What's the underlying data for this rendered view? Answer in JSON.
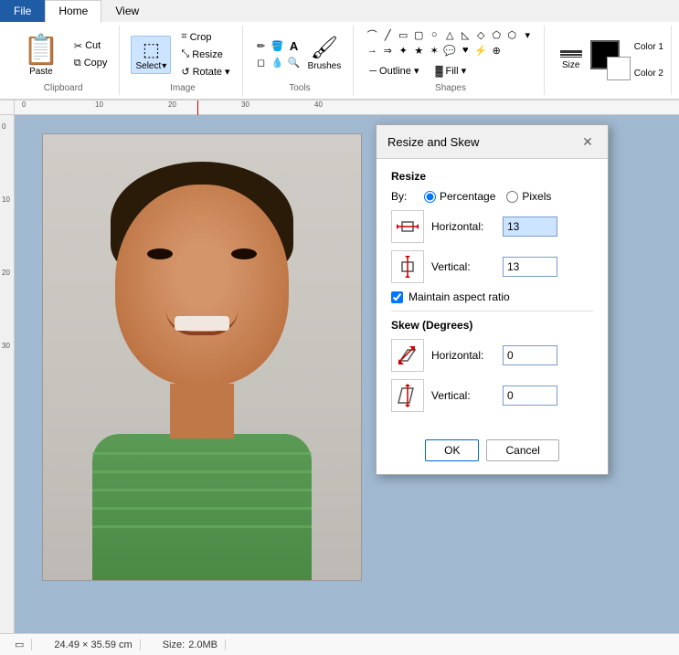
{
  "tabs": [
    {
      "label": "File",
      "id": "file",
      "active": false
    },
    {
      "label": "Home",
      "id": "home",
      "active": true
    },
    {
      "label": "View",
      "id": "view",
      "active": false
    }
  ],
  "ribbon": {
    "clipboard_label": "Clipboard",
    "image_label": "Image",
    "tools_label": "Tools",
    "shapes_label": "Shapes",
    "paste_label": "Paste",
    "cut_label": "Cut",
    "copy_label": "Copy",
    "crop_label": "Crop",
    "resize_label": "Resize",
    "rotate_label": "Rotate",
    "select_label": "Select",
    "brushes_label": "Brushes",
    "outline_label": "Outline ▾",
    "fill_label": "Fill ▾",
    "size_label": "Size",
    "color1_label": "Color 1",
    "color2_label": "Color 2"
  },
  "dialog": {
    "title": "Resize and Skew",
    "resize_section": "Resize",
    "by_label": "By:",
    "percentage_label": "Percentage",
    "pixels_label": "Pixels",
    "horizontal_label": "Horizontal:",
    "vertical_label": "Vertical:",
    "horizontal_resize_value": "13",
    "vertical_resize_value": "13",
    "maintain_aspect_label": "Maintain aspect ratio",
    "skew_section": "Skew (Degrees)",
    "skew_horizontal_value": "0",
    "skew_vertical_value": "0",
    "ok_label": "OK",
    "cancel_label": "Cancel"
  },
  "status": {
    "selection_icon": "▭",
    "dimensions": "24.49 × 35.59 cm",
    "size_label": "Size:",
    "size_value": "2.0MB"
  },
  "ruler": {
    "ticks": [
      "0",
      "10",
      "20",
      "30",
      "40"
    ]
  }
}
